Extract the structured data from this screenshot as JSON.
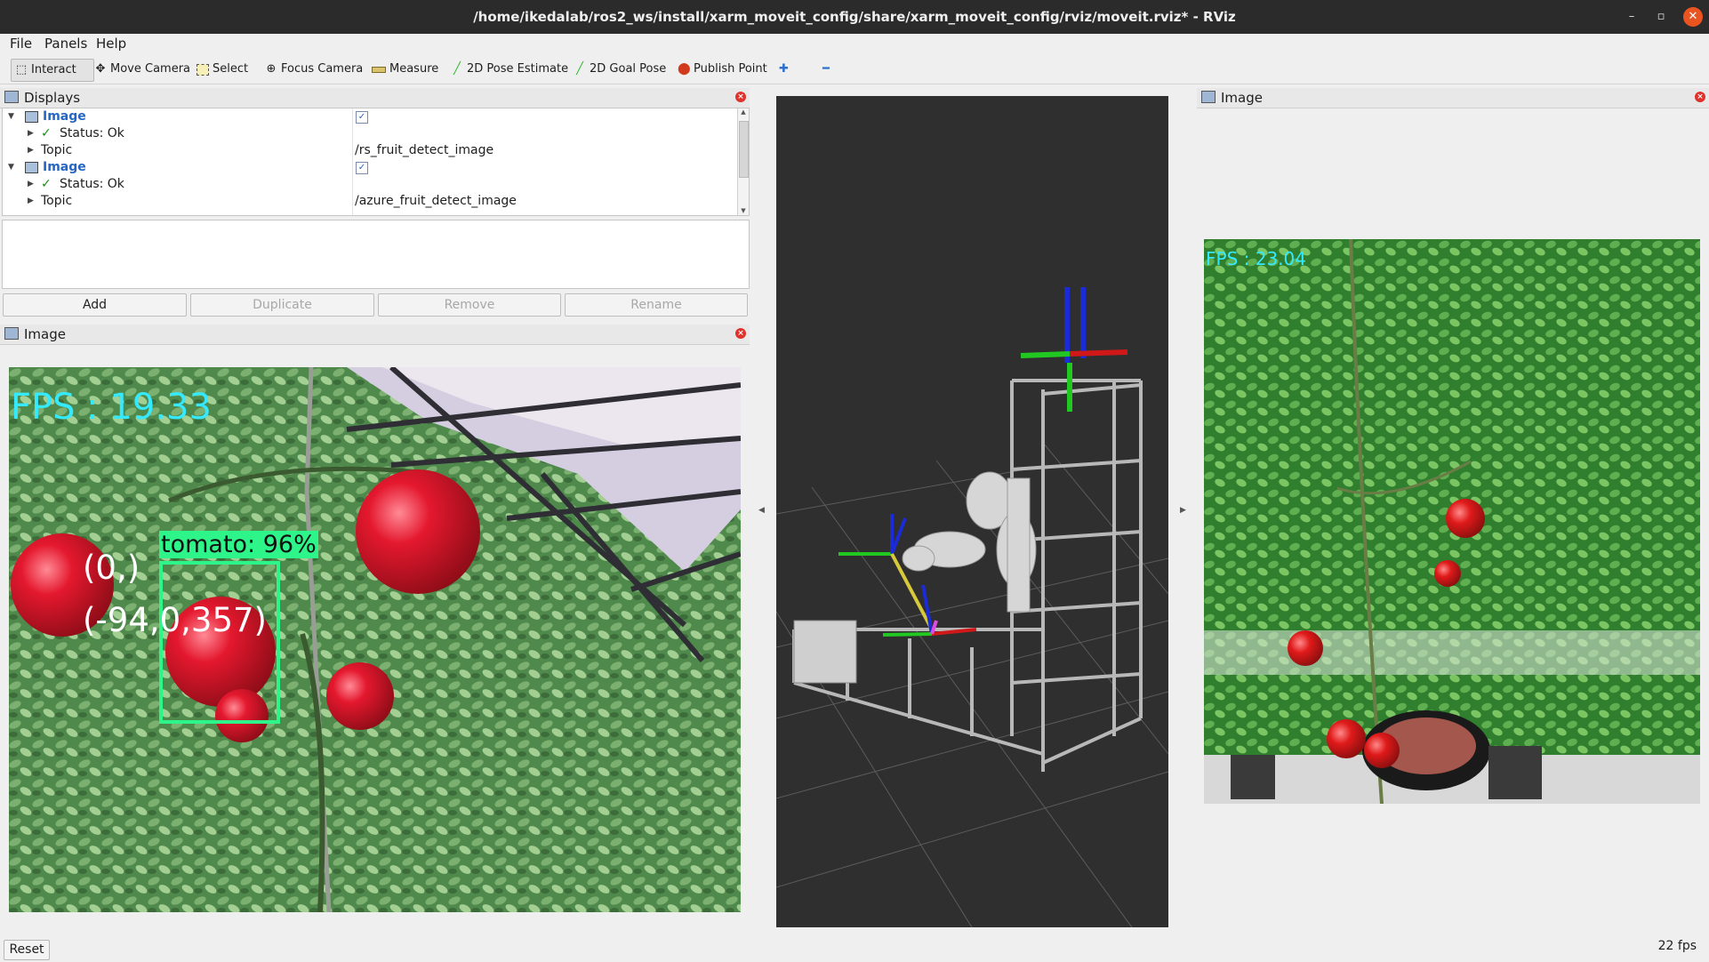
{
  "window": {
    "title": "/home/ikedalab/ros2_ws/install/xarm_moveit_config/share/xarm_moveit_config/rviz/moveit.rviz* - RViz",
    "minimize": "–",
    "maximize": "▫",
    "close": "✕"
  },
  "menu": {
    "file": "File",
    "panels": "Panels",
    "help": "Help"
  },
  "toolbar": {
    "interact": "Interact",
    "move_camera": "Move Camera",
    "select": "Select",
    "focus_camera": "Focus Camera",
    "measure": "Measure",
    "pose_estimate": "2D Pose Estimate",
    "goal_pose": "2D Goal Pose",
    "publish_point": "Publish Point",
    "add_tool": "✚",
    "remove_tool": "━"
  },
  "displays_panel": {
    "title": "Displays",
    "items": [
      {
        "label": "Image",
        "checked": true,
        "status": "Status: Ok",
        "topic_label": "Topic",
        "topic": "/rs_fruit_detect_image"
      },
      {
        "label": "Image",
        "checked": true,
        "status": "Status: Ok",
        "topic_label": "Topic",
        "topic": "/azure_fruit_detect_image"
      }
    ],
    "buttons": {
      "add": "Add",
      "duplicate": "Duplicate",
      "remove": "Remove",
      "rename": "Rename"
    }
  },
  "left_image_panel": {
    "title": "Image",
    "fps_text": "FPS : 19.33",
    "detection_label": "tomato: 96%",
    "coord_line1": "(0,)",
    "coord_line2": "(-94,0,357)"
  },
  "right_image_panel": {
    "title": "Image",
    "fps_text": "FPS : 23.04"
  },
  "status": {
    "reset": "Reset",
    "fps": "22 fps"
  },
  "colors": {
    "accent": "#2566c2",
    "bbox": "#2ef58a",
    "fps_text": "#35e9ff",
    "close": "#e95420"
  }
}
